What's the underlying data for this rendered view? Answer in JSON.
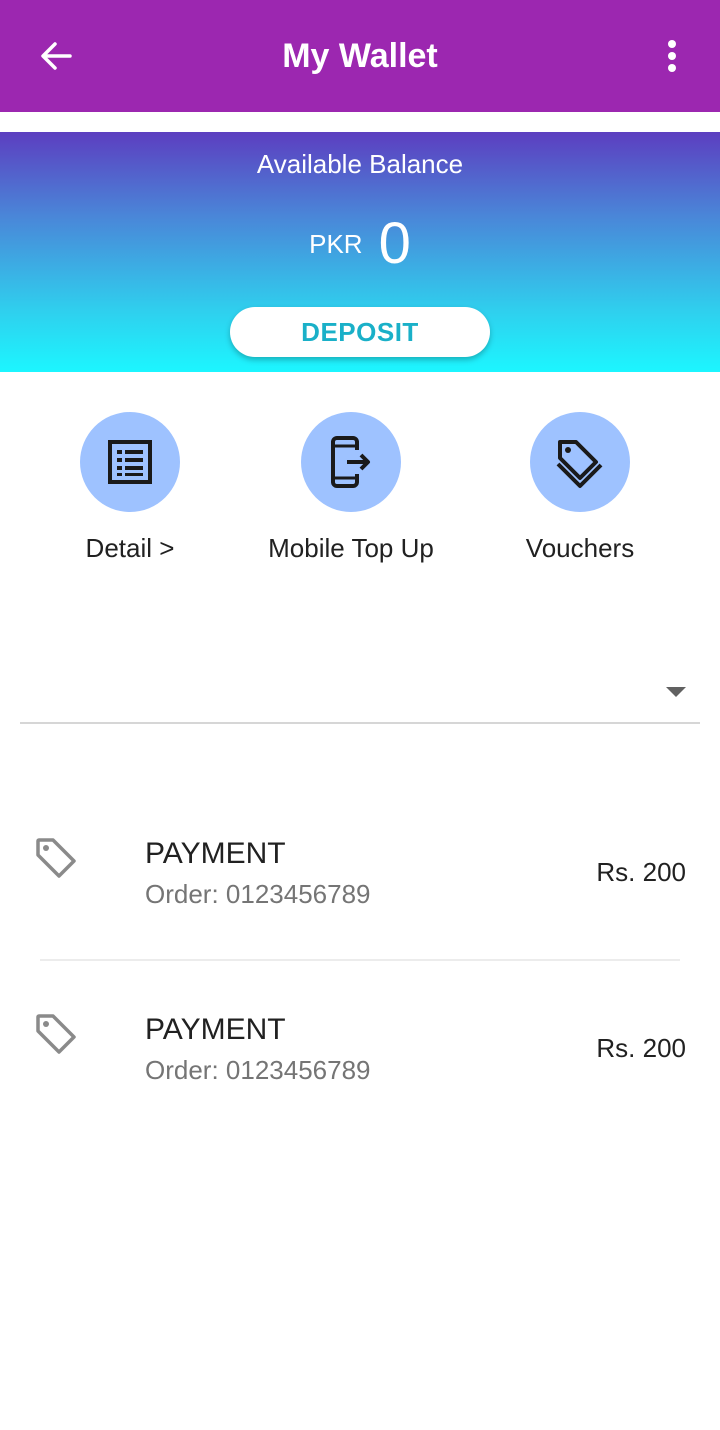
{
  "header": {
    "title": "My Wallet",
    "back_icon": "arrow-left-icon",
    "menu_icon": "more-vertical-icon",
    "color": "#9c27b0"
  },
  "balance": {
    "label": "Available Balance",
    "currency": "PKR",
    "amount": "0",
    "deposit_label": "DEPOSIT",
    "deposit_color": "#1ab0c8"
  },
  "actions": [
    {
      "label": "Detail >",
      "icon": "list-document-icon"
    },
    {
      "label": "Mobile Top Up",
      "icon": "mobile-export-icon"
    },
    {
      "label": "Vouchers",
      "icon": "tags-icon"
    }
  ],
  "filter": {
    "selected": "",
    "icon": "caret-down-icon"
  },
  "transactions": [
    {
      "title": "PAYMENT",
      "subtitle": "Order: 0123456789",
      "amount": "Rs. 200",
      "icon": "tag-icon"
    },
    {
      "title": "PAYMENT",
      "subtitle": "Order: 0123456789",
      "amount": "Rs. 200",
      "icon": "tag-icon"
    }
  ]
}
